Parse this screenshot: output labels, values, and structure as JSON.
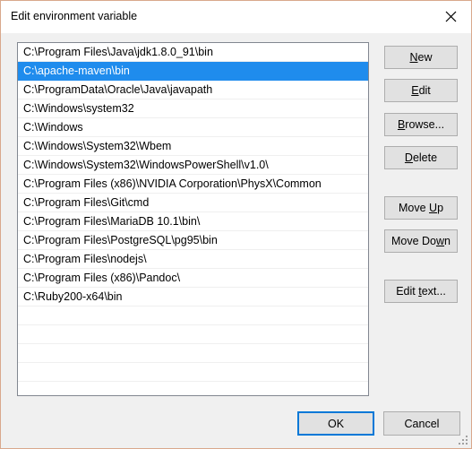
{
  "window": {
    "title": "Edit environment variable",
    "close_icon": "close-icon",
    "border_color": "#d9a88c",
    "titlebar_background": "#ffffff",
    "body_background": "#f0f0f0"
  },
  "list": {
    "selected_index": 1,
    "selection_color": "#1f8ced",
    "selection_text_color": "#ffffff",
    "visible_empty_rows": 6,
    "items": [
      "C:\\Program Files\\Java\\jdk1.8.0_91\\bin",
      "C:\\apache-maven\\bin",
      "C:\\ProgramData\\Oracle\\Java\\javapath",
      "C:\\Windows\\system32",
      "C:\\Windows",
      "C:\\Windows\\System32\\Wbem",
      "C:\\Windows\\System32\\WindowsPowerShell\\v1.0\\",
      "C:\\Program Files (x86)\\NVIDIA Corporation\\PhysX\\Common",
      "C:\\Program Files\\Git\\cmd",
      "C:\\Program Files\\MariaDB 10.1\\bin\\",
      "C:\\Program Files\\PostgreSQL\\pg95\\bin",
      "C:\\Program Files\\nodejs\\",
      "C:\\Program Files (x86)\\Pandoc\\",
      "C:\\Ruby200-x64\\bin"
    ]
  },
  "side_buttons": {
    "new": {
      "before": "",
      "accel": "N",
      "after": "ew"
    },
    "edit": {
      "before": "",
      "accel": "E",
      "after": "dit"
    },
    "browse": {
      "before": "",
      "accel": "B",
      "after": "rowse..."
    },
    "delete": {
      "before": "",
      "accel": "D",
      "after": "elete"
    },
    "move_up": {
      "before": "Move ",
      "accel": "U",
      "after": "p"
    },
    "move_down": {
      "before": "Move Do",
      "accel": "w",
      "after": "n"
    },
    "edit_text": {
      "before": "Edit ",
      "accel": "t",
      "after": "ext..."
    }
  },
  "bottom_buttons": {
    "ok": "OK",
    "cancel": "Cancel",
    "ok_focus_color": "#0078d7"
  }
}
